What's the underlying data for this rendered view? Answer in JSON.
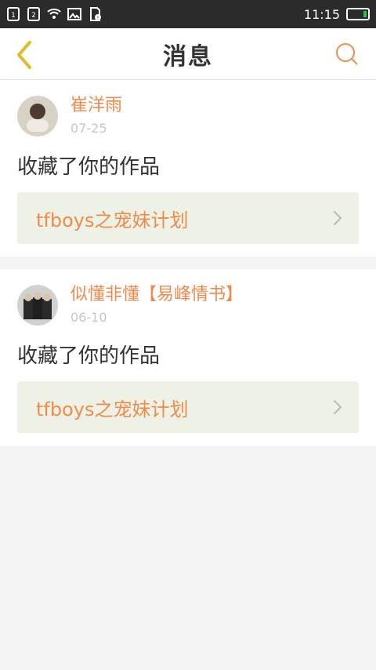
{
  "status": {
    "time": "11:15"
  },
  "header": {
    "title": "消息"
  },
  "messages": [
    {
      "username": "崔洋雨",
      "date": "07-25",
      "action": "收藏了你的作品",
      "work_title": "tfboys之宠妹计划"
    },
    {
      "username": "似懂非懂【易峰情书】",
      "date": "06-10",
      "action": "收藏了你的作品",
      "work_title": "tfboys之宠妹计划"
    }
  ],
  "colors": {
    "accent": "#f08b4b",
    "work_bg": "#eef2e6"
  },
  "icons": {
    "back": "chevron-left-icon",
    "search": "search-icon",
    "sim1": "sim-1-icon",
    "sim2": "sim-2-icon",
    "wifi": "wifi-icon",
    "image": "image-icon",
    "sd": "sd-card-icon",
    "battery": "battery-icon"
  }
}
